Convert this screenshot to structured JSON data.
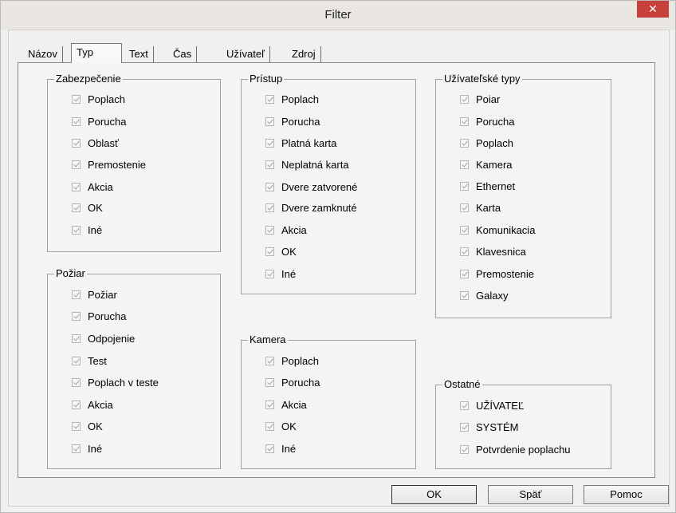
{
  "window": {
    "title": "Filter",
    "close_glyph": "✕"
  },
  "tabs": [
    {
      "label": "Názov"
    },
    {
      "label": "Typ"
    },
    {
      "label": "Text"
    },
    {
      "label": "Čas"
    },
    {
      "label": "Užívateľ"
    },
    {
      "label": "Zdroj"
    }
  ],
  "groups": {
    "zabezpecenie": {
      "title": "Zabezpečenie",
      "items": [
        "Poplach",
        "Porucha",
        "Oblasť",
        "Premostenie",
        "Akcia",
        "OK",
        "Iné"
      ]
    },
    "poziar": {
      "title": "Požiar",
      "items": [
        "Požiar",
        "Porucha",
        "Odpojenie",
        "Test",
        "Poplach v teste",
        "Akcia",
        "OK",
        "Iné"
      ]
    },
    "pristup": {
      "title": "Prístup",
      "items": [
        "Poplach",
        "Porucha",
        "Platná karta",
        "Neplatná karta",
        "Dvere zatvorené",
        "Dvere zamknuté",
        "Akcia",
        "OK",
        "Iné"
      ]
    },
    "kamera": {
      "title": "Kamera",
      "items": [
        "Poplach",
        "Porucha",
        "Akcia",
        "OK",
        "Iné"
      ]
    },
    "uzivatelske": {
      "title": "Užívateľské typy",
      "items": [
        "Poiar",
        "Porucha",
        "Poplach",
        "Kamera",
        "Ethernet",
        "Karta",
        "Komunikacia",
        "Klavesnica",
        "Premostenie",
        "Galaxy"
      ]
    },
    "ostatne": {
      "title": "Ostatné",
      "items": [
        "UŽÍVATEĽ",
        "SYSTÉM",
        "Potvrdenie poplachu"
      ]
    }
  },
  "buttons": {
    "ok": "OK",
    "back": "Späť",
    "help": "Pomoc"
  },
  "colors": {
    "close_button": "#c7413a"
  }
}
